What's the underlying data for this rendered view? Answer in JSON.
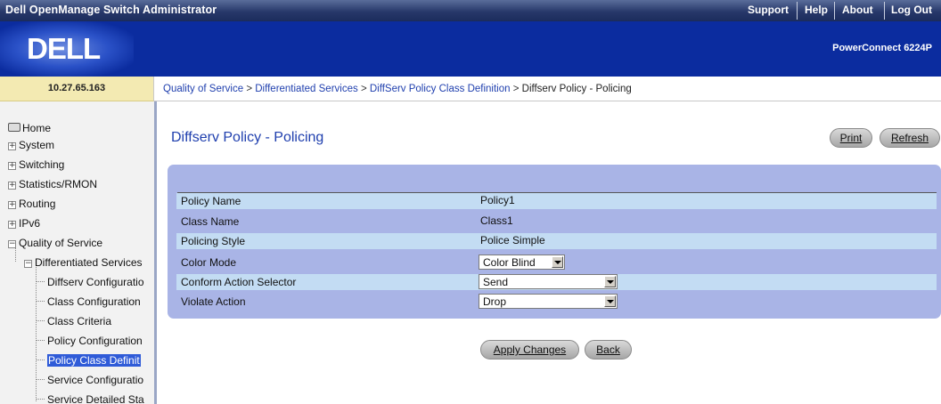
{
  "header": {
    "app_title": "Dell OpenManage Switch Administrator",
    "links": [
      "Support",
      "Help",
      "About",
      "Log Out"
    ]
  },
  "banner": {
    "logo_text": "DELL",
    "model": "PowerConnect 6224P"
  },
  "address": {
    "ip": "10.27.65.163"
  },
  "breadcrumb": {
    "items": [
      "Quality of Service",
      "Differentiated Services",
      "DiffServ Policy Class Definition"
    ],
    "separator": ">",
    "current": "Diffserv Policy - Policing"
  },
  "sidebar": {
    "items": [
      {
        "label": "Home",
        "icon": "home-icon"
      },
      {
        "label": "System",
        "icon": "expand-icon"
      },
      {
        "label": "Switching",
        "icon": "expand-icon"
      },
      {
        "label": "Statistics/RMON",
        "icon": "expand-icon"
      },
      {
        "label": "Routing",
        "icon": "expand-icon"
      },
      {
        "label": "IPv6",
        "icon": "expand-icon"
      },
      {
        "label": "Quality of Service",
        "icon": "collapse-icon"
      },
      {
        "label": "Differentiated Services",
        "icon": "collapse-icon"
      },
      {
        "label": "Diffserv Configuratio"
      },
      {
        "label": "Class Configuration"
      },
      {
        "label": "Class Criteria"
      },
      {
        "label": "Policy Configuration"
      },
      {
        "label": "Policy Class Definit",
        "selected": true
      },
      {
        "label": "Service Configuratio"
      },
      {
        "label": "Service Detailed Sta"
      }
    ]
  },
  "main": {
    "title": "Diffserv Policy - Policing",
    "print_label": "Print",
    "refresh_label": "Refresh",
    "form": {
      "policy_name_label": "Policy Name",
      "policy_name_value": "Policy1",
      "class_name_label": "Class Name",
      "class_name_value": "Class1",
      "policing_style_label": "Policing Style",
      "policing_style_value": "Police Simple",
      "color_mode_label": "Color Mode",
      "color_mode_value": "Color Blind",
      "conform_action_label": "Conform Action Selector",
      "conform_action_value": "Send",
      "violate_action_label": "Violate Action",
      "violate_action_value": "Drop"
    },
    "apply_label": "Apply Changes",
    "back_label": "Back"
  },
  "colors": {
    "header_bg": "#27386a",
    "banner_bg": "#0b2c9f",
    "link": "#1f3fae",
    "panel_bg": "#a9b4e6",
    "row_light": "#c3dcf3",
    "selected_nav": "#2f5bd8"
  }
}
